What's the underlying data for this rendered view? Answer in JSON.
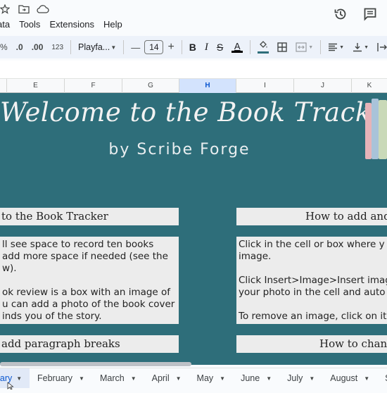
{
  "menu": {
    "items": [
      "ata",
      "Tools",
      "Extensions",
      "Help"
    ]
  },
  "top_icons": [
    "star-icon",
    "move-to-folder-icon",
    "cloud-icon"
  ],
  "right_actions": [
    "history-icon",
    "comment-icon"
  ],
  "toolbar": {
    "percent": "%",
    "decrease_decimal": ".0",
    "increase_decimal": ".00",
    "number_format": "123",
    "font": "Playfa...",
    "minus": "—",
    "font_size": "14",
    "plus": "+",
    "bold": "B",
    "italic": "I",
    "strike": "S",
    "text_color_letter": "A",
    "text_color": "#000000"
  },
  "columns": [
    "E",
    "F",
    "G",
    "H",
    "I",
    "J",
    "K"
  ],
  "selected_column": "H",
  "sheet": {
    "background": "#2e6e7a",
    "title": "Welcome to the Book Tracker",
    "subtitle": "by Scribe Forge",
    "box1_header": "to the Book Tracker",
    "box1_lines": [
      "ll see space to record ten books",
      "add more space if needed (see the",
      "w).",
      "",
      "ok review is a box with an image of",
      "u can add a photo of the book cover",
      "inds you of the story."
    ],
    "box2_header": "How to add and r",
    "box2_lines": [
      "Click in the cell or box where y",
      "image.",
      "",
      "Click Insert>Image>Insert imag",
      "your photo in the cell and auto",
      "",
      "To remove an image, click on it"
    ],
    "box3_header": "add paragraph breaks",
    "box4_header": "How to change"
  },
  "tabs": [
    "nuary",
    "February",
    "March",
    "April",
    "May",
    "June",
    "July",
    "August",
    "Se"
  ],
  "active_tab": "nuary"
}
